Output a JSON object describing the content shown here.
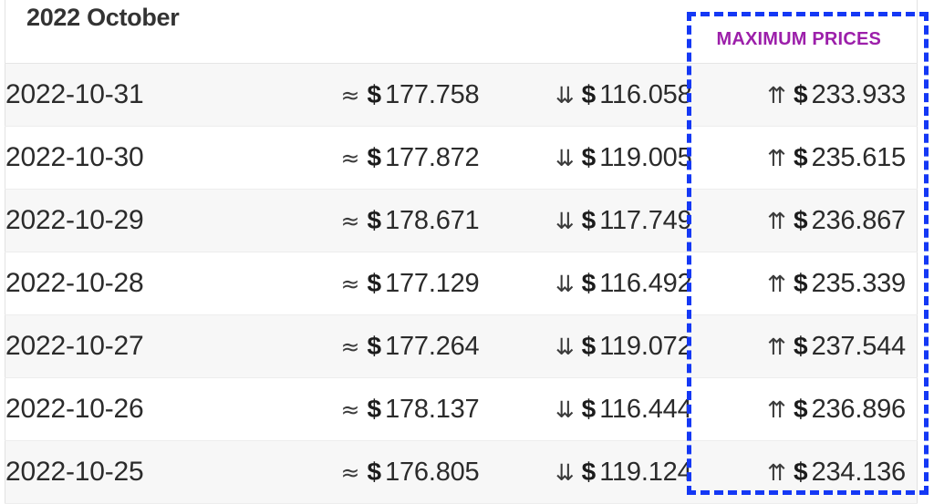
{
  "table": {
    "month_title": "2022 October",
    "columns": [
      {
        "key": "date",
        "header": ""
      },
      {
        "key": "average",
        "header": ""
      },
      {
        "key": "minimum",
        "header": ""
      },
      {
        "key": "maximum",
        "header": "MAXIMUM PRICES"
      }
    ],
    "symbols": {
      "average": "≈",
      "minimum": "⇊",
      "maximum": "⇈",
      "currency": "$"
    },
    "rows": [
      {
        "date": "2022-10-31",
        "average": "177.758",
        "minimum": "116.058",
        "maximum": "233.933"
      },
      {
        "date": "2022-10-30",
        "average": "177.872",
        "minimum": "119.005",
        "maximum": "235.615"
      },
      {
        "date": "2022-10-29",
        "average": "178.671",
        "minimum": "117.749",
        "maximum": "236.867"
      },
      {
        "date": "2022-10-28",
        "average": "177.129",
        "minimum": "116.492",
        "maximum": "235.339"
      },
      {
        "date": "2022-10-27",
        "average": "177.264",
        "minimum": "119.072",
        "maximum": "237.544"
      },
      {
        "date": "2022-10-26",
        "average": "178.137",
        "minimum": "116.444",
        "maximum": "236.896"
      },
      {
        "date": "2022-10-25",
        "average": "176.805",
        "minimum": "119.124",
        "maximum": "234.136"
      }
    ]
  },
  "annotation": {
    "name": "maximum-prices-highlight",
    "color": "#1438f5",
    "style": "dashed"
  },
  "colors": {
    "max_header_text": "#9c1faa",
    "annotation_blue": "#1438f5",
    "title_text": "#333333",
    "row_alt_background": "#f7f7f7",
    "row_background": "#ffffff",
    "row_border": "#ededed"
  }
}
